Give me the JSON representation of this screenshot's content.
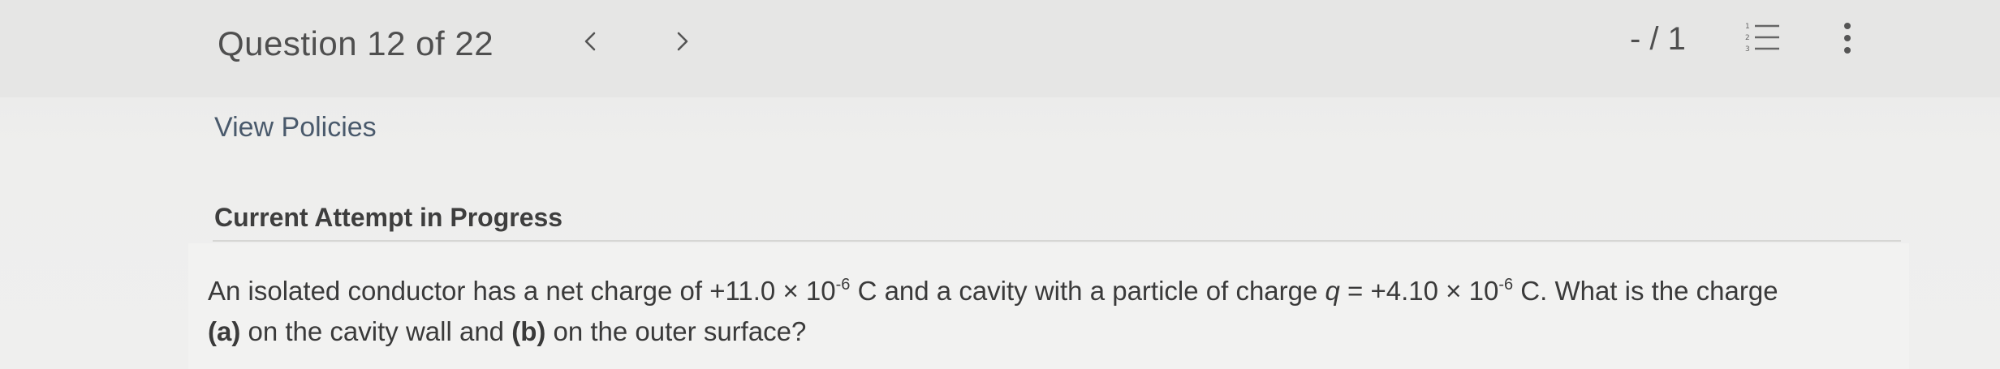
{
  "header": {
    "question_label": "Question 12 of 22",
    "prev_glyph": "<",
    "next_glyph": ">",
    "score": "- / 1",
    "icons": {
      "prev": "chevron-left-icon",
      "next": "chevron-right-icon",
      "list": "numbered-list-icon",
      "menu": "more-vertical-icon"
    }
  },
  "links": {
    "view_policies": "View Policies"
  },
  "attempt": {
    "status": "Current Attempt in Progress"
  },
  "question": {
    "part1": "An isolated conductor has a net charge of +11.0 × 10",
    "exp1": "-6",
    "part2": " C and a cavity with a particle of charge ",
    "var_q": "q",
    "part3": " = +4.10 × 10",
    "exp2": "-6",
    "part4": " C. What is the charge",
    "label_a": "(a)",
    "part5": " on the cavity wall and ",
    "label_b": "(b)",
    "part6": " on the outer surface?"
  },
  "colors": {
    "background": "#ecebea",
    "header": "#e6e6e5",
    "link": "#4a5a6c",
    "text": "#3a3a3a"
  }
}
